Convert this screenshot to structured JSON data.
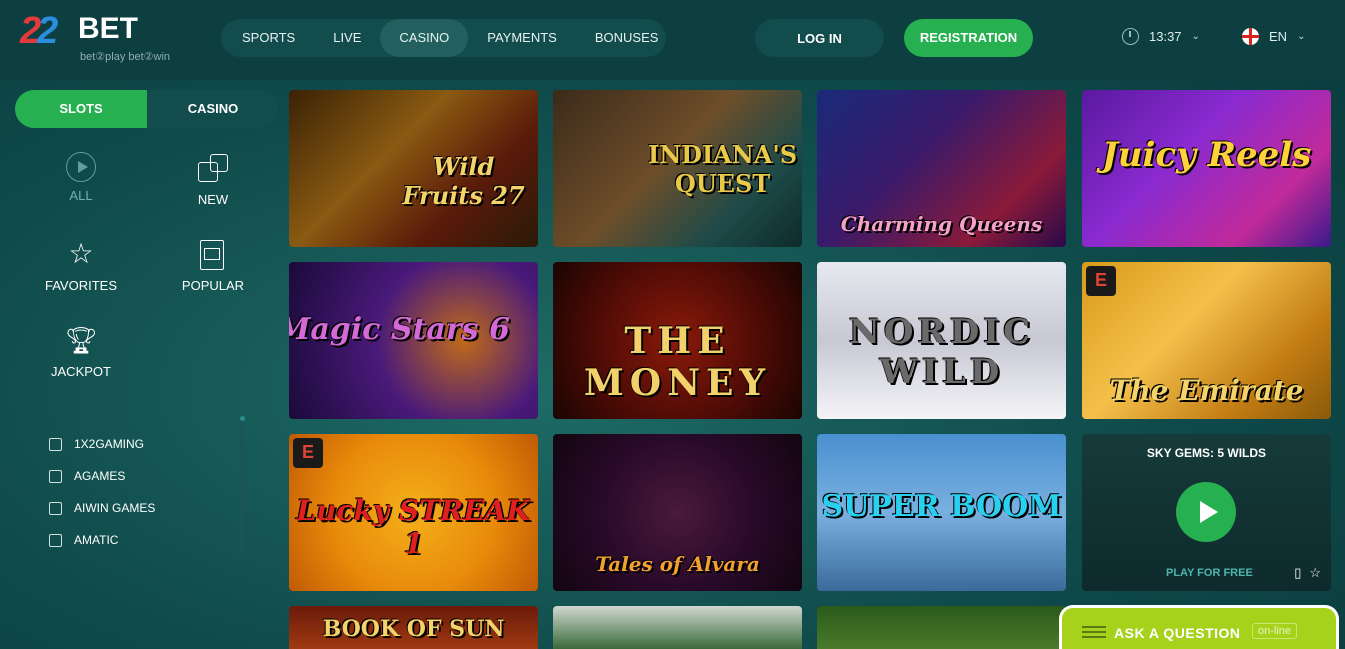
{
  "brand": {
    "logo_num": "22",
    "logo_word": "BET",
    "tagline": "bet②play bet②win"
  },
  "nav": {
    "items": [
      {
        "label": "SPORTS"
      },
      {
        "label": "LIVE"
      },
      {
        "label": "CASINO",
        "active": true
      },
      {
        "label": "PAYMENTS"
      },
      {
        "label": "BONUSES"
      }
    ]
  },
  "header": {
    "login_label": "LOG IN",
    "register_label": "REGISTRATION",
    "time": "13:37",
    "language": "EN"
  },
  "sidebar": {
    "tabs": [
      {
        "label": "SLOTS",
        "active": true
      },
      {
        "label": "CASINO"
      }
    ],
    "categories": [
      {
        "label": "ALL",
        "icon": "play-icon",
        "active": true
      },
      {
        "label": "NEW",
        "icon": "dice-icon"
      },
      {
        "label": "FAVORITES",
        "icon": "star-icon"
      },
      {
        "label": "POPULAR",
        "icon": "slot-machine-icon"
      },
      {
        "label": "JACKPOT",
        "icon": "trophy-icon"
      }
    ],
    "providers": [
      {
        "label": "1X2GAMING"
      },
      {
        "label": "AGAMES"
      },
      {
        "label": "AIWIN GAMES"
      },
      {
        "label": "AMATIC"
      }
    ]
  },
  "games": [
    {
      "title": "Wild Fruits 27"
    },
    {
      "title": "INDIANA'S QUEST"
    },
    {
      "title": "Charming Queens"
    },
    {
      "title": "Juicy Reels"
    },
    {
      "title": "Magic Stars 6"
    },
    {
      "title": "THE MONEY"
    },
    {
      "title": "NORDIC WILD"
    },
    {
      "title": "The Emirate"
    },
    {
      "title": "Lucky STREAK 1"
    },
    {
      "title": "Tales of Alvara"
    },
    {
      "title": "SUPER BOOM"
    },
    {
      "title": "SKY GEMS: 5 WILDS",
      "hover_cta": "PLAY FOR FREE"
    },
    {
      "title": "BOOK OF SUN"
    },
    {
      "title": ""
    },
    {
      "title": ""
    }
  ],
  "chat": {
    "label": "ASK A QUESTION",
    "status": "on-line"
  },
  "colors": {
    "accent_green": "#26b04f",
    "chat_green": "#a6d21c",
    "header_bg": "#0d3e40"
  }
}
